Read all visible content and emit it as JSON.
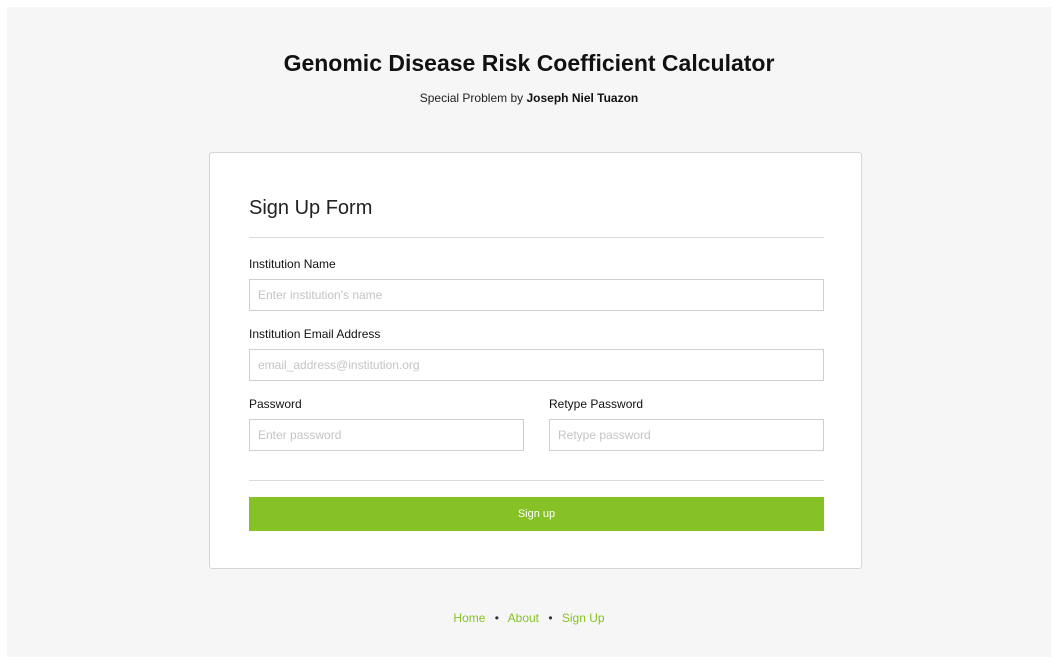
{
  "header": {
    "title": "Genomic Disease Risk Coefficient Calculator",
    "subtitle_prefix": "Special Problem by",
    "author": "Joseph Niel Tuazon"
  },
  "form": {
    "title": "Sign Up Form",
    "institution_name": {
      "label": "Institution Name",
      "placeholder": "Enter institution's name",
      "value": ""
    },
    "institution_email": {
      "label": "Institution Email Address",
      "placeholder": "email_address@institution.org",
      "value": ""
    },
    "password": {
      "label": "Password",
      "placeholder": "Enter password",
      "value": ""
    },
    "retype_password": {
      "label": "Retype Password",
      "placeholder": "Retype password",
      "value": ""
    },
    "submit_label": "Sign up"
  },
  "footer": {
    "links": [
      "Home",
      "About",
      "Sign Up"
    ],
    "separator": "•"
  },
  "colors": {
    "accent": "#86c226",
    "background": "#f6f6f6"
  }
}
